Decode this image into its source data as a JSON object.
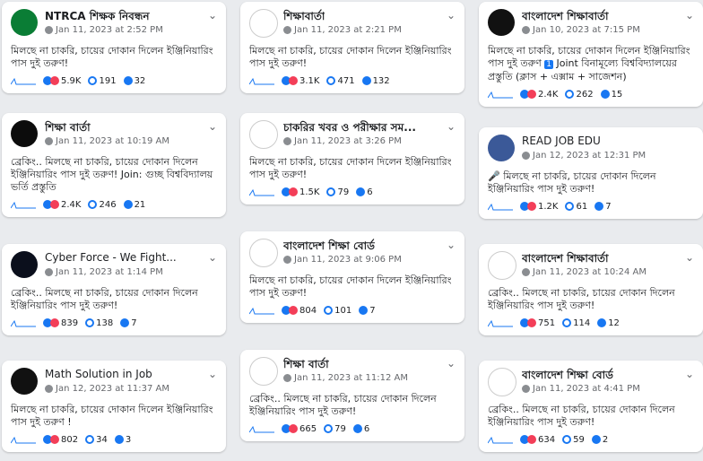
{
  "posts": [
    {
      "name": "NTRCA শিক্ষক নিবন্ধন",
      "time": "Jan 11, 2023 at 2:52 PM",
      "text": "মিলছে না চাকরি, চায়ের দোকান দিলেন ইঞ্জিনিয়ারিং পাস দুই তরুণ!",
      "reactions": "5.9K",
      "comments": "191",
      "shares": "32"
    },
    {
      "name": "শিক্ষাবার্তা",
      "time": "Jan 11, 2023 at 2:21 PM",
      "text": "মিলছে না চাকরি, চায়ের দোকান দিলেন ইঞ্জিনিয়ারিং পাস দুই তরুণ!",
      "reactions": "3.1K",
      "comments": "471",
      "shares": "132"
    },
    {
      "name": "বাংলাদেশ শিক্ষাবার্তা",
      "time": "Jan 10, 2023 at 7:15 PM",
      "text": "মিলছে না চাকরি, চায়ের দোকান দিলেন ইঞ্জিনিয়ারিং পাস দুই তরুণ",
      "badge": "1",
      "text2": "Joint বিনামূল্যে বিশ্ববিদ্যালয়ের প্রস্তুতি (ক্লাস + এক্সাম + সাজেশন)",
      "reactions": "2.4K",
      "comments": "262",
      "shares": "15"
    },
    {
      "name": "শিক্ষা বার্তা",
      "time": "Jan 11, 2023 at 10:19 AM",
      "text": "ব্রেকিং.. মিলছে না চাকরি, চায়ের দোকান দিলেন ইঞ্জিনিয়ারিং পাস দুই তরুণ! Join: গুচ্ছ বিশ্ববিদ্যালয় ভর্তি প্রস্তুতি",
      "reactions": "2.4K",
      "comments": "246",
      "shares": "21"
    },
    {
      "name": "চাকরির খবর ও পরীক্ষার সম...",
      "time": "Jan 11, 2023 at 3:26 PM",
      "text": "মিলছে না চাকরি, চায়ের দোকান দিলেন ইঞ্জিনিয়ারিং পাস দুই তরুণ!",
      "reactions": "1.5K",
      "comments": "79",
      "shares": "6"
    },
    {
      "name": "READ JOB EDU",
      "time": "Jan 12, 2023 at 12:31 PM",
      "text": "🎤 মিলছে না চাকরি, চায়ের দোকান দিলেন ইঞ্জিনিয়ারিং পাস দুই তরুণ!",
      "reactions": "1.2K",
      "comments": "61",
      "shares": "7"
    },
    {
      "name": "Cyber Force - We Fight...",
      "time": "Jan 11, 2023 at 1:14 PM",
      "text": "ব্রেকিং.. মিলছে না চাকরি, চায়ের দোকান দিলেন ইঞ্জিনিয়ারিং পাস দুই তরুণ!",
      "reactions": "839",
      "comments": "138",
      "shares": "7"
    },
    {
      "name": "বাংলাদেশ শিক্ষা বোর্ড",
      "time": "Jan 11, 2023 at 9:06 PM",
      "text": "মিলছে না চাকরি, চায়ের দোকান দিলেন ইঞ্জিনিয়ারিং পাস দুই তরুণ!",
      "reactions": "804",
      "comments": "101",
      "shares": "7"
    },
    {
      "name": "বাংলাদেশ শিক্ষাবার্তা",
      "time": "Jan 11, 2023 at 10:24 AM",
      "text": "ব্রেকিং.. মিলছে না চাকরি, চায়ের দোকান দিলেন ইঞ্জিনিয়ারিং পাস দুই তরুণ!",
      "reactions": "751",
      "comments": "114",
      "shares": "12"
    },
    {
      "name": "Math Solution in Job",
      "time": "Jan 12, 2023 at 11:37 AM",
      "text": "মিলছে না চাকরি, চায়ের দোকান দিলেন ইঞ্জিনিয়ারিং পাস দুই তরুণ !",
      "reactions": "802",
      "comments": "34",
      "shares": "3"
    },
    {
      "name": "শিক্ষা বার্তা",
      "time": "Jan 11, 2023 at 11:12 AM",
      "text": "ব্রেকিং.. মিলছে না চাকরি, চায়ের দোকান দিলেন ইঞ্জিনিয়ারিং পাস দুই তরুণ!",
      "reactions": "665",
      "comments": "79",
      "shares": "6"
    },
    {
      "name": "বাংলাদেশ শিক্ষা বোর্ড",
      "time": "Jan 11, 2023 at 4:41 PM",
      "text": "ব্রেকিং.. মিলছে না চাকরি, চায়ের দোকান দিলেন ইঞ্জিনিয়ারিং পাস দুই তরুণ!",
      "reactions": "634",
      "comments": "59",
      "shares": "2"
    }
  ],
  "avatar_colors": [
    "#0a7d35",
    "#ffffff",
    "#111111",
    "#0c0c0c",
    "#ffffff",
    "#3b5998",
    "#0b0f1c",
    "#ffffff",
    "#ffffff",
    "#111111",
    "#ffffff",
    "#ffffff"
  ]
}
